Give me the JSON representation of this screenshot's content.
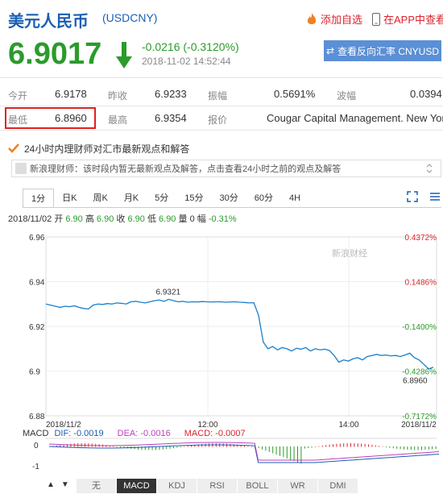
{
  "header": {
    "title": "美元人民币",
    "code": "(USDCNY)",
    "add_watch": "添加自选",
    "app_view": "在APP中查看"
  },
  "quote": {
    "price": "6.9017",
    "change": "-0.0216 (-0.3120%)",
    "timestamp": "2018-11-02 14:52:44",
    "reverse_button": "查看反向汇率 CNYUSD"
  },
  "stats": {
    "row1": [
      {
        "label": "今开",
        "value": "6.9178"
      },
      {
        "label": "昨收",
        "value": "6.9233"
      },
      {
        "label": "振幅",
        "value": "0.5691%"
      },
      {
        "label": "波幅",
        "value": "0.0394"
      }
    ],
    "row2": [
      {
        "label": "最低",
        "value": "6.8960"
      },
      {
        "label": "最高",
        "value": "6.9354"
      },
      {
        "label": "报价",
        "value": "Cougar Capital Management. New York"
      }
    ]
  },
  "news": {
    "headline": "24小时内理财师对汇市最新观点和解答",
    "notice": "新浪理财师：该时段内暂无最新观点及解答，点击查看24小时之前的观点及解答"
  },
  "chart_tabs": [
    "1分",
    "日K",
    "周K",
    "月K",
    "5分",
    "15分",
    "30分",
    "60分",
    "4H"
  ],
  "ohlc": {
    "date": "2018/11/02",
    "open_label": "开",
    "open": "6.90",
    "high_label": "高",
    "high": "6.90",
    "close_label": "收",
    "close": "6.90",
    "low_label": "低",
    "low": "6.90",
    "vol_label": "量",
    "vol": "0",
    "amp_label": "幅",
    "amp": "-0.31%"
  },
  "watermark": "新浪财经",
  "chart_data": {
    "type": "line",
    "ylim": [
      6.88,
      6.96
    ],
    "yticks": [
      "6.96",
      "6.94",
      "6.92",
      "6.9",
      "6.88"
    ],
    "right_ticks": [
      "0.4372%",
      "0.1486%",
      "-0.1400%",
      "-0.4286%",
      "-0.7172%"
    ],
    "xticks": [
      "2018/11/2",
      "12:00",
      "14:00",
      "2018/11/2"
    ],
    "annotation_high": "6.9321",
    "annotation_low": "6.8960",
    "series": [
      {
        "values": [
          6.93,
          6.9295,
          6.929,
          6.9285,
          6.929,
          6.9288,
          6.9292,
          6.9285,
          6.928,
          6.9278,
          6.9295,
          6.93,
          6.9298,
          6.9302,
          6.93,
          6.9305,
          6.9303,
          6.93,
          6.931,
          6.9312,
          6.9308,
          6.9305,
          6.931,
          6.9315,
          6.9318,
          6.9312,
          6.9321,
          6.9315,
          6.931,
          6.9312,
          6.9308,
          6.931,
          6.9309,
          6.9311,
          6.931,
          6.9309,
          6.931,
          6.931,
          6.9308,
          6.9309,
          6.931,
          6.9308,
          6.9307,
          6.9305,
          6.9306,
          6.925,
          6.913,
          6.91,
          6.911,
          6.9095,
          6.9105,
          6.91,
          6.909,
          6.9102,
          6.9098,
          6.9105,
          6.909,
          6.91,
          6.9095,
          6.9098,
          6.9092,
          6.907,
          6.904,
          6.905,
          6.9045,
          6.9055,
          6.906,
          6.905,
          6.9065,
          6.907,
          6.9075,
          6.907,
          6.9072,
          6.9068,
          6.907,
          6.9065,
          6.9072,
          6.908,
          6.906,
          6.905,
          6.903,
          6.901,
          6.9017
        ]
      }
    ]
  },
  "macd": {
    "label": "MACD",
    "dif": "DIF: -0.0019",
    "dea": "DEA: -0.0016",
    "macd": "MACD: -0.0007",
    "axis": [
      "0",
      "-1"
    ]
  },
  "bottom_tabs": [
    "无",
    "MACD",
    "KDJ",
    "RSI",
    "BOLL",
    "WR",
    "DMI"
  ],
  "colors": {
    "up": "#d9232c",
    "down": "#2b9b2b",
    "line": "#1a7fcb",
    "accent": "#1a5fb4"
  }
}
